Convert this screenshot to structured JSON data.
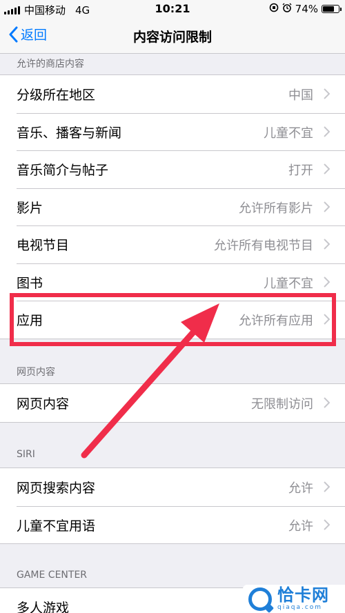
{
  "status_bar": {
    "carrier": "中国移动",
    "network": "4G",
    "time": "10:21",
    "battery": "74%",
    "battery_level": 0.74
  },
  "nav": {
    "back_label": "返回",
    "title": "内容访问限制"
  },
  "sections": [
    {
      "header": "允许的商店内容",
      "rows": [
        {
          "label": "分级所在地区",
          "value": "中国"
        },
        {
          "label": "音乐、播客与新闻",
          "value": "儿童不宜"
        },
        {
          "label": "音乐简介与帖子",
          "value": "打开"
        },
        {
          "label": "影片",
          "value": "允许所有影片"
        },
        {
          "label": "电视节目",
          "value": "允许所有电视节目"
        },
        {
          "label": "图书",
          "value": "儿童不宜"
        },
        {
          "label": "应用",
          "value": "允许所有应用"
        }
      ]
    },
    {
      "header": "网页内容",
      "rows": [
        {
          "label": "网页内容",
          "value": "无限制访问"
        }
      ]
    },
    {
      "header": "SIRI",
      "rows": [
        {
          "label": "网页搜索内容",
          "value": "允许"
        },
        {
          "label": "儿童不宜用语",
          "value": "允许"
        }
      ]
    },
    {
      "header": "GAME CENTER",
      "rows": [
        {
          "label": "多人游戏",
          "value": ""
        }
      ]
    }
  ],
  "watermark": {
    "name": "恰卡网",
    "domain": "qiaqa.com"
  },
  "colors": {
    "accent": "#007aff",
    "annotation": "#f02d4a",
    "watermark": "#1f7fd8"
  }
}
